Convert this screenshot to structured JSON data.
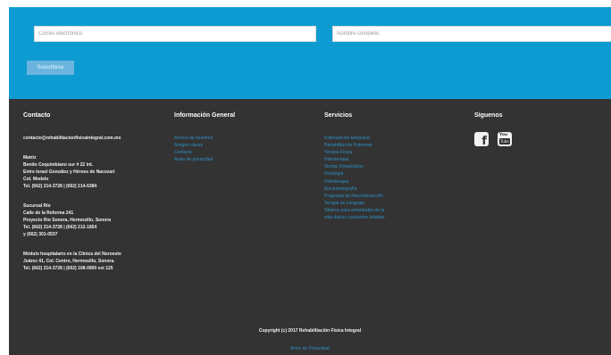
{
  "subscribe": {
    "email_placeholder": "Correo electrónico",
    "name_placeholder": "Nombre completo",
    "button_label": "Suscribirse"
  },
  "contact": {
    "title": "Contacto",
    "email": "contacto@rehabilitacionfisicaintegral.com.mx",
    "matriz": [
      "Matriz",
      "Benito Coquimbiano sur # 22 int.",
      "Entre Israel González y Héroes de Nacozari",
      "Col. Modelo",
      "Tel. (662) 214-3728 | (662) 214-6384"
    ],
    "sucursal": [
      "Sucursal Río",
      "Calle de la Reforma 241",
      "Proyecto Río Sonora, Hermosillo, Sonora",
      "Tel. (662) 214-3728 | (662) 212-1854",
      "y (662) 301-0537"
    ],
    "modulo": [
      "Módulo hospitalario en la Clínica del Noroeste",
      "Juárez 41, Col. Centro, Hermosillo, Sonora.",
      "Tel. (662) 214-3728 | (662) 108-0900 ext 125"
    ]
  },
  "info": {
    "title": "Información General",
    "links": [
      "Acerca de nosotros",
      "Amigos claves",
      "Contacto",
      "Aviso de privacidad"
    ]
  },
  "services": {
    "title": "Servicios",
    "links": [
      "Estimulación temprana",
      "Rehabilitación Pulmonar",
      "Terapia Física",
      "Hidroterapia",
      "Ventas Ortopédicas",
      "Fisiología",
      "Hidroterapia",
      "Electromiografía",
      "Programa de Neurodesarrollo",
      "Terapia de Lenguaje",
      "Talleres para actividades de la",
      "vida diaria y pacientes lisiados"
    ]
  },
  "social": {
    "title": "Síguenos",
    "youtube_top": "You",
    "youtube_box": "Tube"
  },
  "footer": {
    "copyright": "Copyright (c) 2017 Rehabilitación Física Integral",
    "privacy": "Aviso de Privacidad"
  },
  "colors": {
    "accent_blue": "#0e9bd1",
    "footer_bg": "#333333",
    "link_blue": "#2f8fc4",
    "button_blue": "#6ab4de"
  },
  "icons": [
    "facebook-icon",
    "youtube-icon"
  ]
}
